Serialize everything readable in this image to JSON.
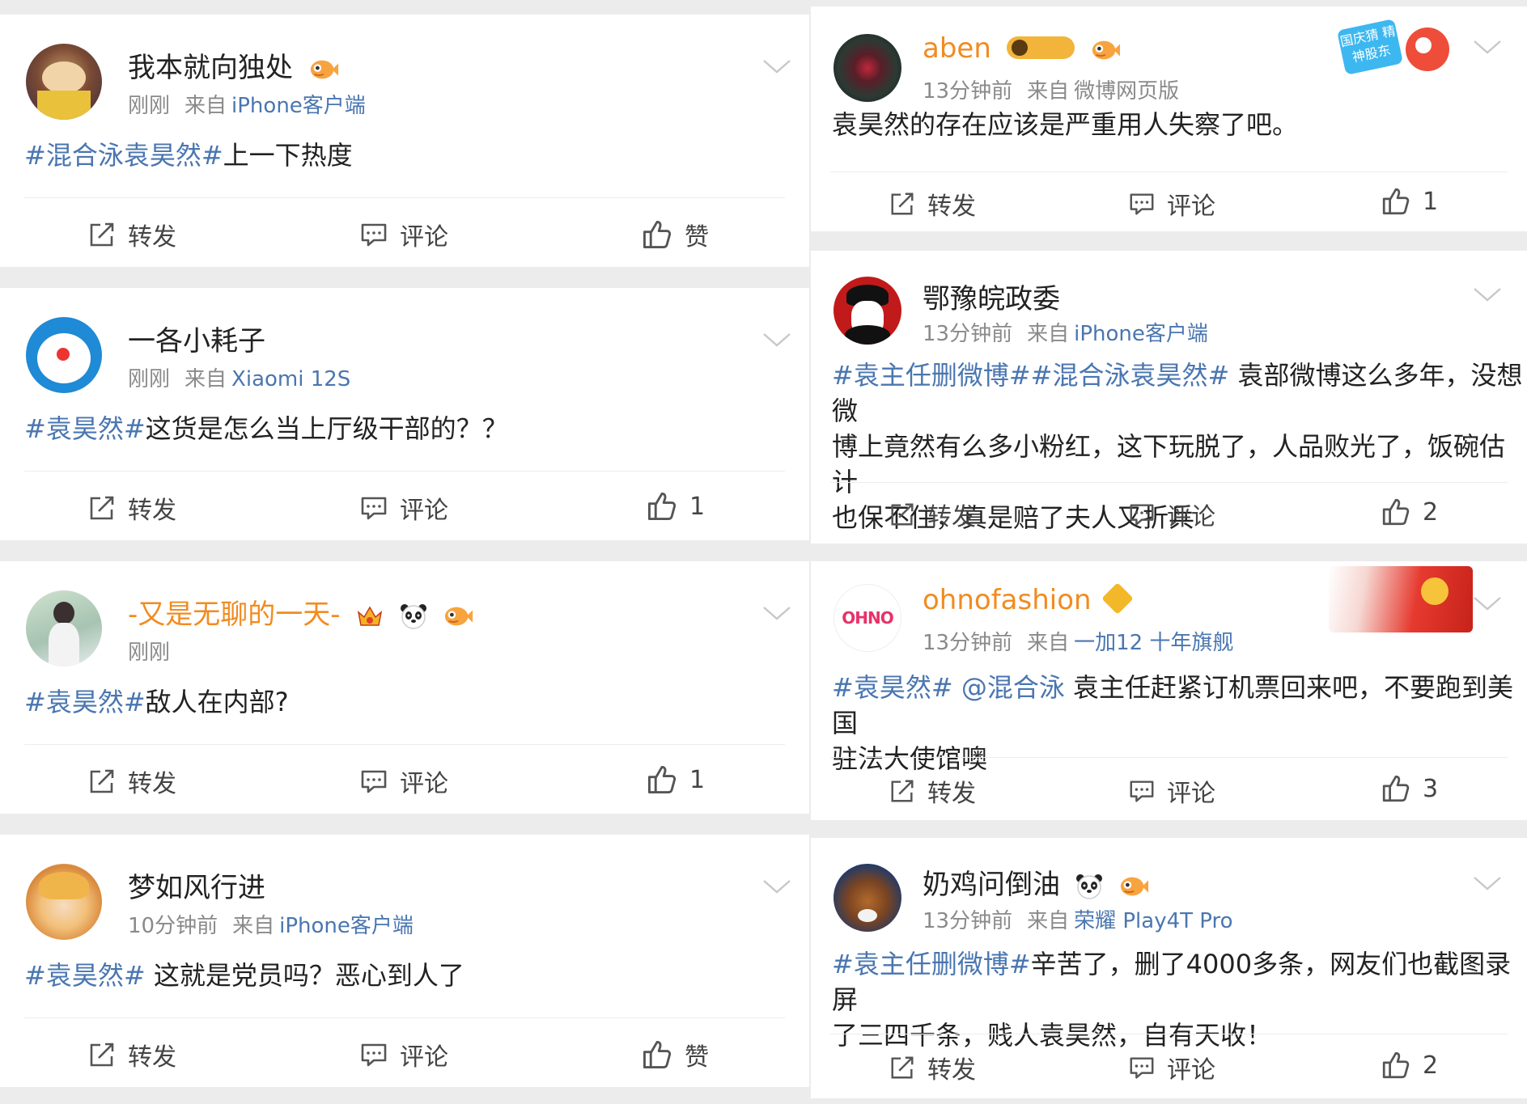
{
  "actions": {
    "repost": "转发",
    "comment": "评论",
    "like_zero": "赞"
  },
  "left": [
    {
      "name": "我本就向独处",
      "time": "刚刚",
      "source_prefix": "来自",
      "device": "iPhone客户端",
      "tag": "#混合泳袁昊然#",
      "text": "上一下热度",
      "likes": "赞"
    },
    {
      "name": "一各小耗子",
      "time": "刚刚",
      "source_prefix": "来自",
      "device": "Xiaomi 12S",
      "tag": "#袁昊然#",
      "text": "这货是怎么当上厅级干部的？？",
      "likes": "1"
    },
    {
      "name": "-又是无聊的一天-",
      "time": "刚刚",
      "source_prefix": "",
      "device": "",
      "tag": "#袁昊然#",
      "text": "敌人在内部?",
      "likes": "1"
    },
    {
      "name": "梦如风行进",
      "time": "10分钟前",
      "source_prefix": "来自",
      "device": "iPhone客户端",
      "tag": "#袁昊然#",
      "text": " 这就是党员吗？恶心到人了",
      "likes": "赞"
    }
  ],
  "right": [
    {
      "name": "aben",
      "time": "13分钟前",
      "source_prefix": "来自",
      "device": "微博网页版",
      "text": "袁昊然的存在应该是严重用人失察了吧。",
      "likes": "1",
      "badge_text": "国庆猜 精神股东"
    },
    {
      "name": "鄂豫皖政委",
      "time": "13分钟前",
      "source_prefix": "来自",
      "device": "iPhone客户端",
      "tag": "#袁主任删微博##混合泳袁昊然#",
      "line1": " 袁部微博这么多年，没想微",
      "line2": "博上竟然有么多小粉红，这下玩脱了，人品败光了，饭碗估计",
      "line3": "也保不住，真是赔了夫人又折兵",
      "likes": "2"
    },
    {
      "name": "ohnofashion",
      "time": "13分钟前",
      "source_prefix": "来自",
      "device": "一加12 十年旗舰",
      "tag": "#袁昊然#",
      "mention": " @混合泳",
      "line1": " 袁主任赶紧订机票回来吧，不要跑到美国",
      "line2": "驻法大使馆噢",
      "likes": "3",
      "avatar_text": "OHNO"
    },
    {
      "name": "奶鸡问倒油",
      "time": "13分钟前",
      "source_prefix": "来自",
      "device": "荣耀 Play4T Pro",
      "tag": "#袁主任删微博#",
      "line1": "辛苦了，删了4000多条，网友们也截图录屏",
      "line2": "了三四千条，贱人袁昊然，自有天收！",
      "likes": "2"
    }
  ],
  "colors": {
    "link": "#4a76b0",
    "orange_name": "#f28b1f",
    "meta": "#8a8a8a",
    "bg": "#ececec"
  }
}
